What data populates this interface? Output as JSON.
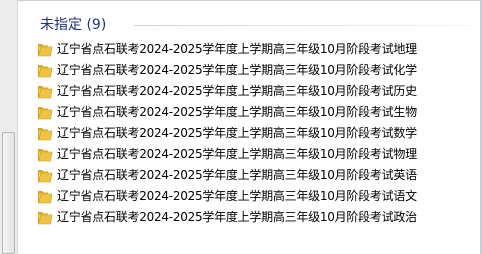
{
  "group": {
    "title": "未指定 (9)"
  },
  "items": [
    {
      "name": "辽宁省点石联考2024-2025学年度上学期高三年级10月阶段考试地理",
      "icon": "folder-icon"
    },
    {
      "name": "辽宁省点石联考2024-2025学年度上学期高三年级10月阶段考试化学",
      "icon": "folder-icon"
    },
    {
      "name": "辽宁省点石联考2024-2025学年度上学期高三年级10月阶段考试历史",
      "icon": "folder-icon"
    },
    {
      "name": "辽宁省点石联考2024-2025学年度上学期高三年级10月阶段考试生物",
      "icon": "folder-icon"
    },
    {
      "name": "辽宁省点石联考2024-2025学年度上学期高三年级10月阶段考试数学",
      "icon": "folder-icon"
    },
    {
      "name": "辽宁省点石联考2024-2025学年度上学期高三年级10月阶段考试物理",
      "icon": "folder-icon"
    },
    {
      "name": "辽宁省点石联考2024-2025学年度上学期高三年级10月阶段考试英语",
      "icon": "folder-icon"
    },
    {
      "name": "辽宁省点石联考2024-2025学年度上学期高三年级10月阶段考试语文",
      "icon": "folder-icon"
    },
    {
      "name": "辽宁省点石联考2024-2025学年度上学期高三年级10月阶段考试政治",
      "icon": "folder-icon"
    }
  ],
  "colors": {
    "group_title": "#1e3287",
    "folder_body": "#f0c441",
    "folder_tab": "#d9a520"
  }
}
